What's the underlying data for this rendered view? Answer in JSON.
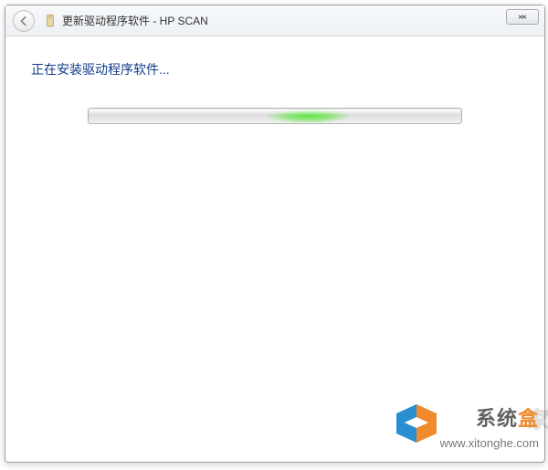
{
  "titlebar": {
    "title": "更新驱动程序软件 - HP SCAN"
  },
  "content": {
    "status": "正在安装驱动程序软件..."
  },
  "watermark": {
    "brand_prefix": "系统",
    "brand_accent": "盒",
    "brand_shadow": "家",
    "url": "www.xitonghe.com"
  }
}
